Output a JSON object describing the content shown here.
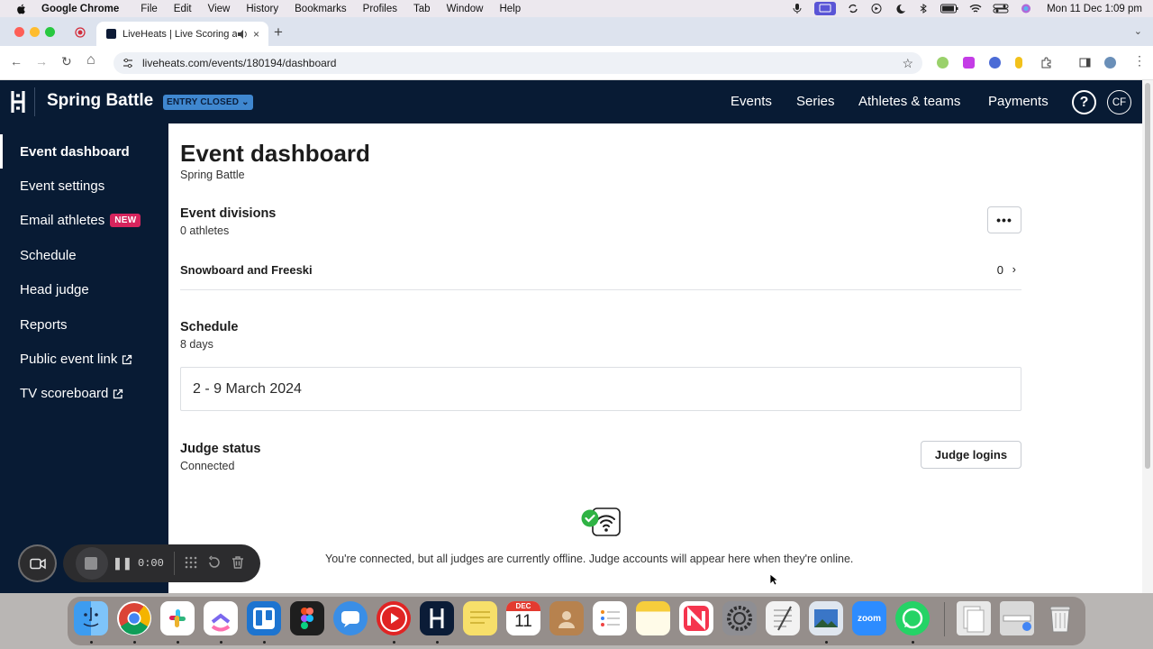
{
  "macos_menubar": {
    "app_name": "Google Chrome",
    "menus": [
      "File",
      "Edit",
      "View",
      "History",
      "Bookmarks",
      "Profiles",
      "Tab",
      "Window",
      "Help"
    ],
    "clock": "Mon 11 Dec  1:09 pm"
  },
  "browser": {
    "tab_title": "LiveHeats | Live Scoring a",
    "new_tab_glyph": "+",
    "url": "liveheats.com/events/180194/dashboard",
    "nav_glyphs": {
      "back": "←",
      "forward": "→",
      "reload": "↻",
      "home": "⌂",
      "star": "☆",
      "tab_close": "×",
      "tab_list": "⌄",
      "menu": "⋮"
    }
  },
  "header": {
    "event_name": "Spring Battle",
    "entry_status": "ENTRY CLOSED ⌄",
    "nav": [
      "Events",
      "Series",
      "Athletes & teams",
      "Payments"
    ],
    "help_label": "?",
    "avatar_initials": "CF"
  },
  "sidebar": {
    "items": [
      {
        "label": "Event dashboard",
        "active": true
      },
      {
        "label": "Event settings"
      },
      {
        "label": "Email athletes",
        "badge": "NEW"
      },
      {
        "label": "Schedule"
      },
      {
        "label": "Head judge"
      },
      {
        "label": "Reports"
      },
      {
        "label": "Public event link",
        "external": true
      },
      {
        "label": "TV scoreboard",
        "external": true
      }
    ]
  },
  "main": {
    "title": "Event dashboard",
    "subtitle": "Spring Battle",
    "divisions": {
      "heading": "Event divisions",
      "count_label": "0 athletes",
      "more_label": "•••",
      "rows": [
        {
          "name": "Snowboard and Freeski",
          "count": "0",
          "chevron": "›"
        }
      ]
    },
    "schedule": {
      "heading": "Schedule",
      "duration": "8 days",
      "date_range": "2 - 9 March 2024"
    },
    "judges": {
      "heading": "Judge status",
      "status": "Connected",
      "logins_button": "Judge logins",
      "offline_message": "You're connected, but all judges are currently offline. Judge accounts will appear here when they're online."
    }
  },
  "recorder": {
    "time": "0:00",
    "pause_glyph": "❚❚"
  },
  "dock": {
    "apps": [
      "finder",
      "chrome",
      "slack",
      "clickup",
      "trello",
      "figma",
      "messages",
      "youtube",
      "liveheats",
      "stickies",
      "calendar",
      "contacts",
      "reminders",
      "notes",
      "news",
      "settings",
      "textedit",
      "preview",
      "zoom",
      "whatsapp"
    ],
    "calendar_month": "DEC",
    "calendar_day": "11",
    "zoom_label": "zoom"
  },
  "colors": {
    "navy": "#081b34",
    "badge_blue": "#3f87cf",
    "new_badge": "#d7245d",
    "check_green": "#2fb344"
  }
}
